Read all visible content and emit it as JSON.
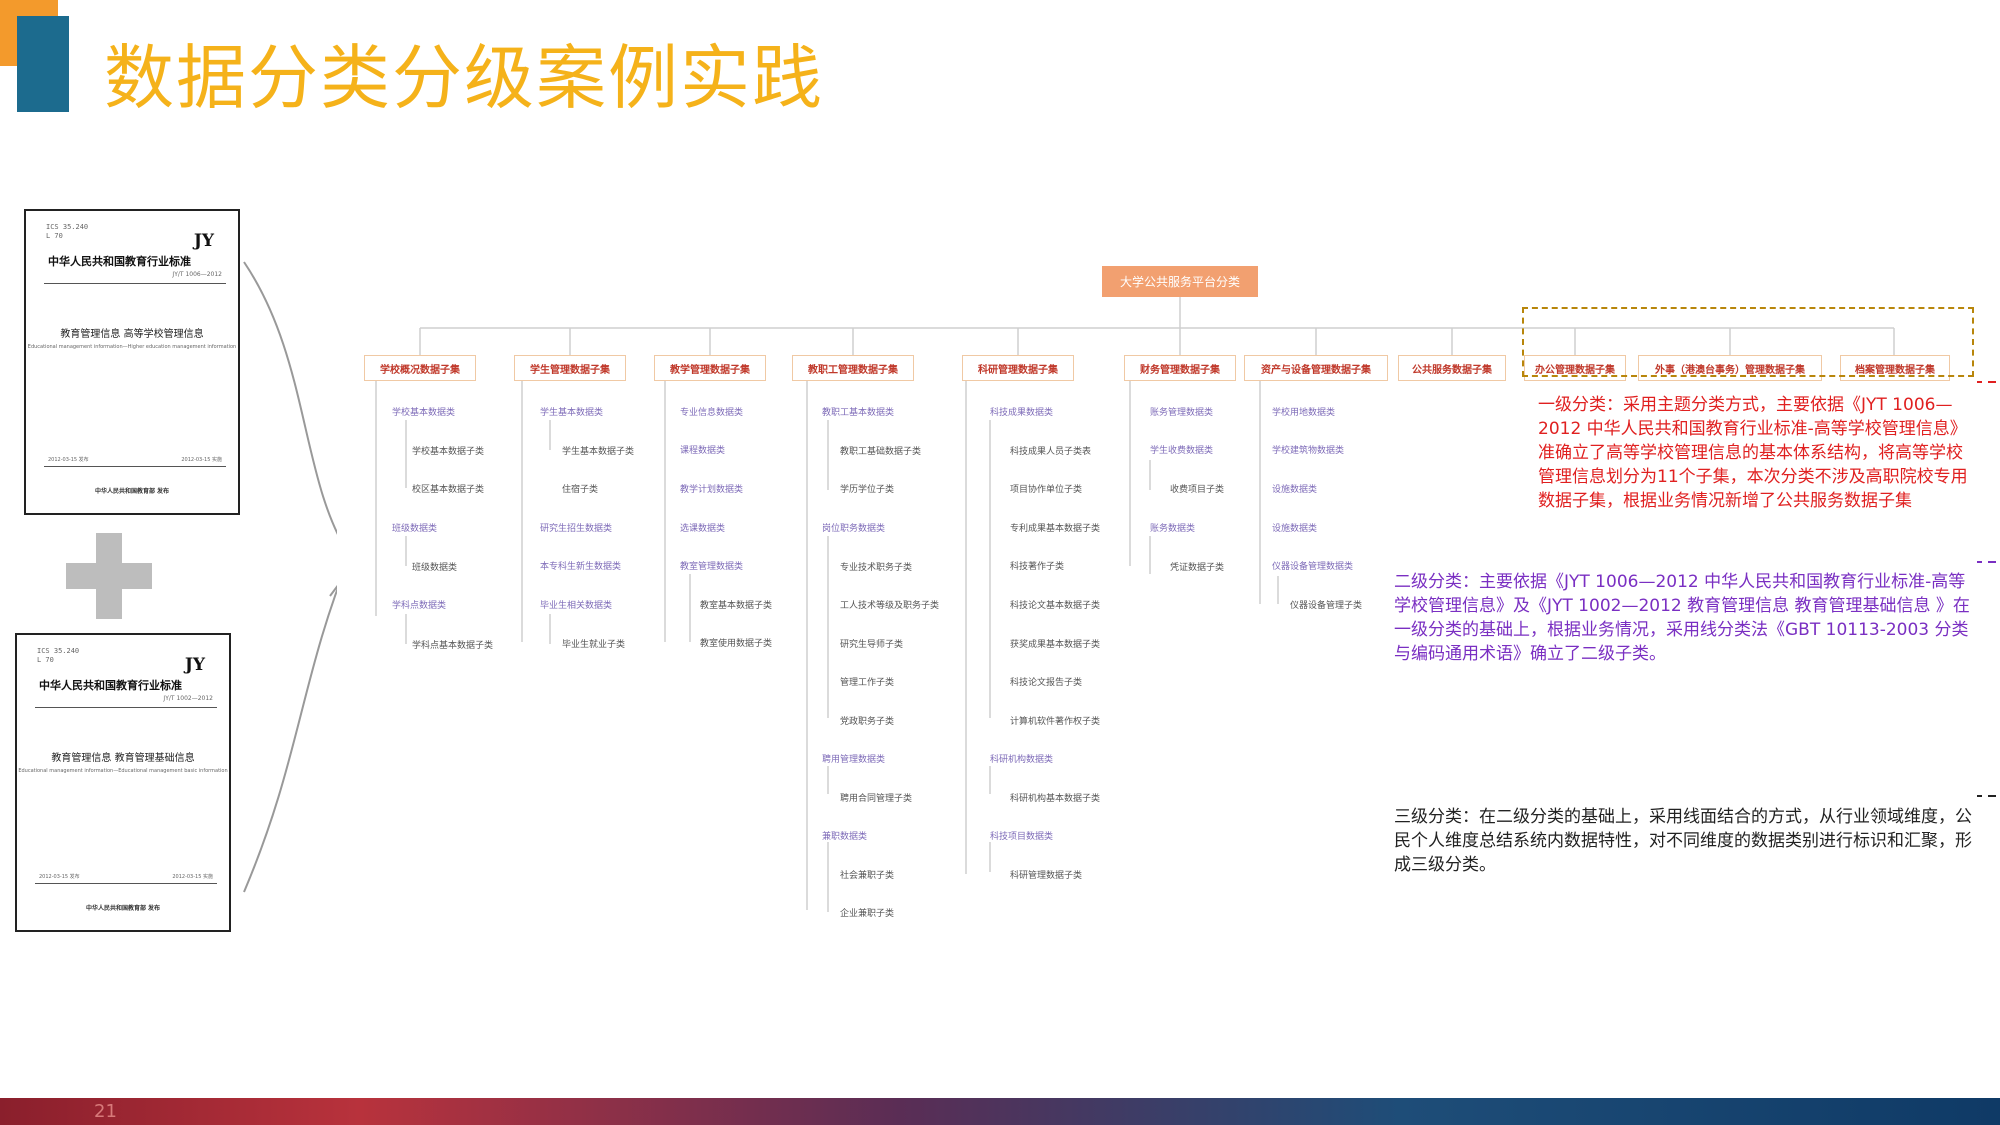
{
  "title": "数据分类分级案例实践",
  "page_number": "21",
  "docs": [
    {
      "code": "ICS 35.240\nL 70",
      "jy": "JY",
      "standard": "中华人民共和国教育行业标准",
      "std_no": "JY/T 1006—2012",
      "title": "教育管理信息 高等学校管理信息",
      "sub": "Educational management information—Higher education management information",
      "date_left": "2012-03-15 发布",
      "date_right": "2012-03-15 实施",
      "publisher": "中华人民共和国教育部 发布"
    },
    {
      "code": "ICS 35.240\nL 70",
      "jy": "JY",
      "standard": "中华人民共和国教育行业标准",
      "std_no": "JY/T 1002—2012",
      "title": "教育管理信息 教育管理基础信息",
      "sub": "Educational management information—Educational management basic information",
      "date_left": "2012-03-15 发布",
      "date_right": "2012-03-15 实施",
      "publisher": "中华人民共和国教育部 发布"
    }
  ],
  "tree": {
    "root": "大学公共服务平台分类",
    "level1": [
      "学校概况数据子集",
      "学生管理数据子集",
      "教学管理数据子集",
      "教职工管理数据子集",
      "科研管理数据子集",
      "财务管理数据子集",
      "资产与设备管理数据子集",
      "公共服务数据子集",
      "办公管理数据子集",
      "外事（港澳台事务）管理数据子集",
      "档案管理数据子集"
    ],
    "col1": {
      "l2": [
        "学校基本数据类",
        "班级数据类",
        "学科点数据类"
      ],
      "l3": [
        "学校基本数据子类",
        "校区基本数据子类",
        "班级数据类",
        "学科点基本数据子类"
      ]
    },
    "col2": {
      "l2": [
        "学生基本数据类",
        "研究生招生数据类",
        "本专科生新生数据类",
        "毕业生相关数据类"
      ],
      "l3": [
        "学生基本数据子类",
        "住宿子类",
        "毕业生就业子类"
      ]
    },
    "col3": {
      "l2": [
        "专业信息数据类",
        "课程数据类",
        "教学计划数据类",
        "选课数据类",
        "教室管理数据类"
      ],
      "l3": [
        "教室基本数据子类",
        "教室使用数据子类"
      ]
    },
    "col4": {
      "l2": [
        "教职工基本数据类",
        "岗位职务数据类",
        "聘用管理数据类",
        "兼职数据类"
      ],
      "l3": [
        "教职工基础数据子类",
        "学历学位子类",
        "专业技术职务子类",
        "工人技术等级及职务子类",
        "研究生导师子类",
        "管理工作子类",
        "党政职务子类",
        "聘用合同管理子类",
        "社会兼职子类",
        "企业兼职子类"
      ]
    },
    "col5": {
      "l2": [
        "科技成果数据类",
        "科研机构数据类",
        "科技项目数据类"
      ],
      "l3": [
        "科技成果人员子类表",
        "项目协作单位子类",
        "专利成果基本数据子类",
        "科技著作子类",
        "科技论文基本数据子类",
        "获奖成果基本数据子类",
        "科技论文报告子类",
        "计算机软件著作权子类",
        "科研机构基本数据子类",
        "科研管理数据子类"
      ]
    },
    "col6": {
      "l2": [
        "账务管理数据类",
        "学生收费数据类",
        "账务数据类"
      ],
      "l3": [
        "收费项目子类",
        "凭证数据子类"
      ]
    },
    "col7": {
      "l2": [
        "学校用地数据类",
        "学校建筑物数据类",
        "设施数据类",
        "设施数据类",
        "仪器设备管理数据类"
      ],
      "l3": [
        "仪器设备管理子类"
      ]
    }
  },
  "annotations": {
    "level1": "一级分类：采用主题分类方式，主要依据《JYT 1006—2012 中华人民共和国教育行业标准-高等学校管理信息》准确立了高等学校管理信息的基本体系结构，将高等学校管理信息划分为11个子集，本次分类不涉及高职院校专用数据子集，根据业务情况新增了公共服务数据子集",
    "level2": "二级分类：主要依据《JYT 1006—2012 中华人民共和国教育行业标准-高等学校管理信息》及《JYT 1002—2012 教育管理信息 教育管理基础信息 》在一级分类的基础上，根据业务情况，采用线分类法《GBT 10113-2003 分类与编码通用术语》确立了二级子类。",
    "level3": "三级分类：在二级分类的基础上，采用线面结合的方式，从行业领域维度，公民个人维度总结系统内数据特性，对不同维度的数据类别进行标识和汇聚，形成三级分类。"
  },
  "colors": {
    "title": "#f5b21a",
    "accent_teal": "#1c6b8e",
    "accent_orange": "#f39a2c",
    "annotation_red": "#e02020",
    "annotation_purple": "#7a2fc2",
    "node_root": "#f2a070",
    "level1_text": "#c0392b",
    "level2_text": "#7e6bb8"
  }
}
